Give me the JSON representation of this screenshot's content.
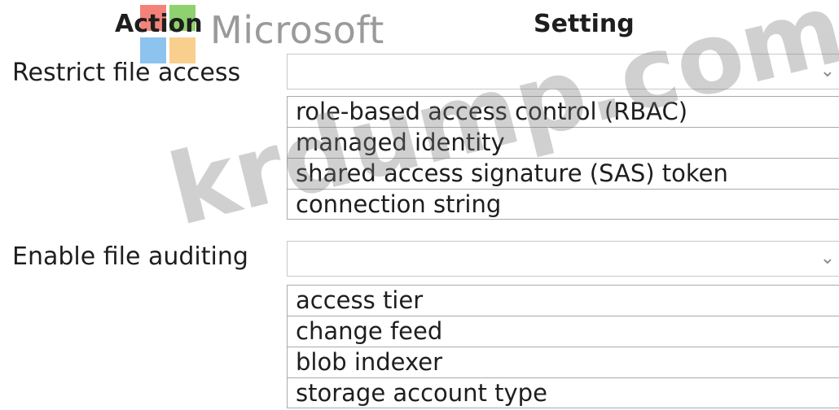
{
  "brand": {
    "name": "Microsoft",
    "logo_icon": "windows-logo-icon"
  },
  "headers": {
    "action": "Action",
    "setting": "Setting"
  },
  "rows": [
    {
      "action": "Restrict file access",
      "options": [
        "role-based access control (RBAC)",
        "managed identity",
        "shared access signature (SAS) token",
        "connection string"
      ]
    },
    {
      "action": "Enable file auditing",
      "options": [
        "access tier",
        "change feed",
        "blob indexer",
        "storage account type"
      ]
    }
  ],
  "watermark": "krdump.com",
  "icons": {
    "dropdown": "chevron-down-icon"
  }
}
